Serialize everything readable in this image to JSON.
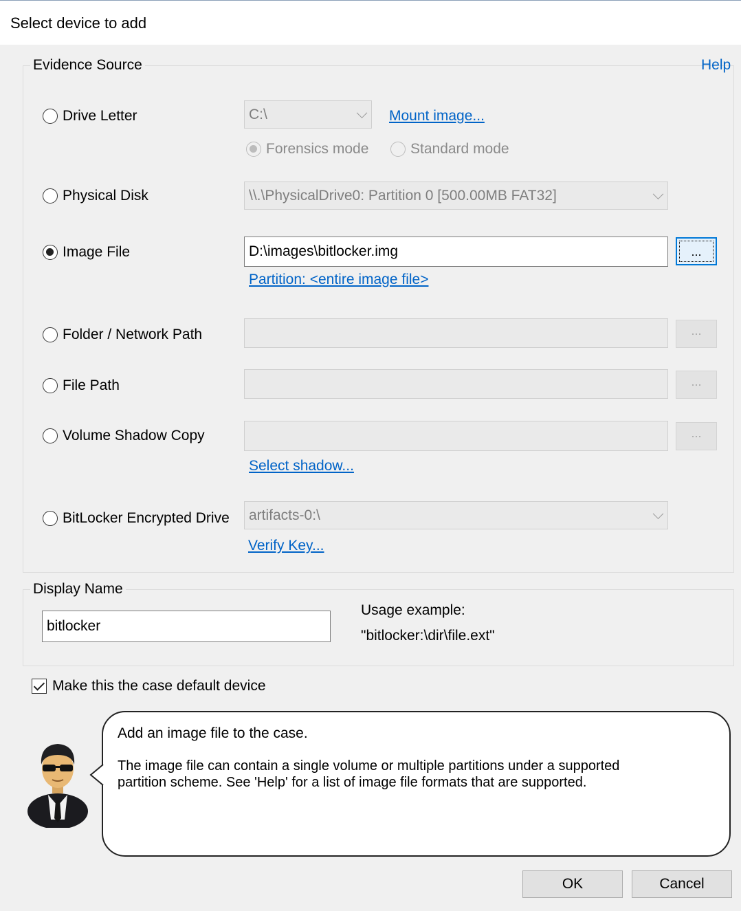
{
  "window": {
    "title": "Select device to add"
  },
  "evidence_source": {
    "legend": "Evidence Source",
    "help_label": "Help",
    "drive_letter": {
      "label": "Drive Letter",
      "value": "C:\\",
      "mount_link": "Mount image...",
      "forensics_mode": "Forensics mode",
      "standard_mode": "Standard mode"
    },
    "physical_disk": {
      "label": "Physical Disk",
      "value": "\\\\.\\PhysicalDrive0: Partition 0 [500.00MB FAT32]"
    },
    "image_file": {
      "label": "Image File",
      "value": "D:\\images\\bitlocker.img",
      "browse_label": "...",
      "partition_link": "Partition: <entire image file>"
    },
    "folder_network": {
      "label": "Folder / Network Path",
      "value": "",
      "browse_label": "..."
    },
    "file_path": {
      "label": "File Path",
      "value": "",
      "browse_label": "..."
    },
    "volume_shadow": {
      "label": "Volume Shadow Copy",
      "value": "",
      "browse_label": "...",
      "select_link": "Select shadow..."
    },
    "bitlocker": {
      "label": "BitLocker Encrypted Drive",
      "value": "artifacts-0:\\",
      "verify_link": "Verify Key..."
    },
    "selected": "image_file"
  },
  "display_name": {
    "legend": "Display Name",
    "value": "bitlocker",
    "usage_label": "Usage example:",
    "usage_value": "\"bitlocker:\\dir\\file.ext\""
  },
  "default_device": {
    "label": "Make this the case default device",
    "checked": true
  },
  "assistant": {
    "icon": "agent-avatar-icon",
    "line1": "Add an image file to the case.",
    "line2": "The image file can contain a single volume or multiple partitions under a supported",
    "line3": "partition scheme. See 'Help' for a list of image file formats that are supported."
  },
  "buttons": {
    "ok": "OK",
    "cancel": "Cancel"
  },
  "colors": {
    "link": "#0063c7",
    "focus": "#0078d7"
  }
}
